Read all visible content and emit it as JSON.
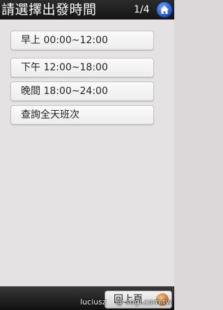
{
  "header": {
    "title": "請選擇出發時間",
    "page_indicator": "1/4"
  },
  "options": [
    {
      "label": "早上 00:00~12:00"
    },
    {
      "label": "下午 12:00~18:00"
    },
    {
      "label": "晚間 18:00~24:00"
    },
    {
      "label": "查詢全天班次"
    }
  ],
  "footer": {
    "back_label": "回上頁"
  },
  "watermark": {
    "user": "luciusz",
    "site": "@ sogi.com.tw"
  },
  "colors": {
    "header_bg": "#1c1c1c",
    "content_bg": "#e5e2e3",
    "home_button": "#2b62d8"
  }
}
